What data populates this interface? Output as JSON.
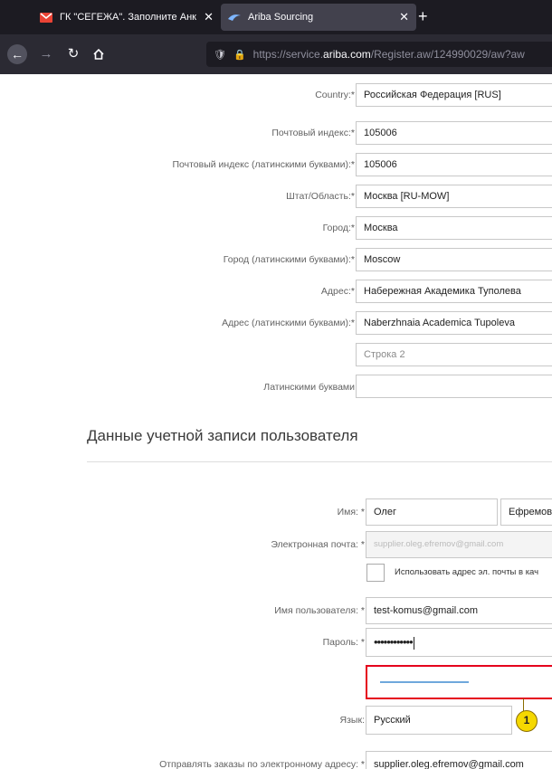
{
  "browser": {
    "tabs": [
      {
        "title": "ГК \"СЕГЕЖА\". Заполните Анк",
        "icon": "mail-icon",
        "close": "✕"
      },
      {
        "title": "Ariba Sourcing",
        "icon": "ariba-icon",
        "close": "✕"
      }
    ],
    "new_tab": "+",
    "url_prefix": "https://service.",
    "url_domain": "ariba.com",
    "url_suffix": "/Register.aw/124990029/aw?aw"
  },
  "address_form": {
    "country": {
      "label": "Country:",
      "value": "Российская Федерация [RUS]"
    },
    "postal": {
      "label": "Почтовый индекс:",
      "value": "105006"
    },
    "postal_latin": {
      "label": "Почтовый индекс (латинскими буквами):",
      "value": "105006"
    },
    "state": {
      "label": "Штат/Область:",
      "value": "Москва [RU-MOW]"
    },
    "city": {
      "label": "Город:",
      "value": "Москва"
    },
    "city_latin": {
      "label": "Город (латинскими буквами):",
      "value": "Moscow"
    },
    "address": {
      "label": "Адрес:",
      "value": "Набережная Академика Туполева"
    },
    "address_latin": {
      "label": "Адрес (латинскими буквами):",
      "value": "Naberzhnaia Academica Tupoleva"
    },
    "line2": {
      "placeholder": "Строка 2"
    },
    "latin_label": "Латинскими буквами"
  },
  "user_section": {
    "title": "Данные учетной записи пользователя",
    "name": {
      "label": "Имя:",
      "first": "Олег",
      "last": "Ефремов"
    },
    "email": {
      "label": "Электронная почта:",
      "value": "supplier.oleg.efremov@gmail.com"
    },
    "use_email_checkbox": "Использовать адрес эл. почты в кач",
    "username": {
      "label": "Имя пользователя:",
      "value": "test-komus@gmail.com"
    },
    "password": {
      "label": "Пароль:",
      "value": "••••••••••••"
    },
    "language": {
      "label": "Язык:",
      "value": "Русский"
    },
    "orders_email": {
      "label": "Отправлять заказы по электронному адресу:",
      "value": "supplier.oleg.efremov@gmail.com"
    }
  },
  "required_mark": "*",
  "callout_number": "1"
}
